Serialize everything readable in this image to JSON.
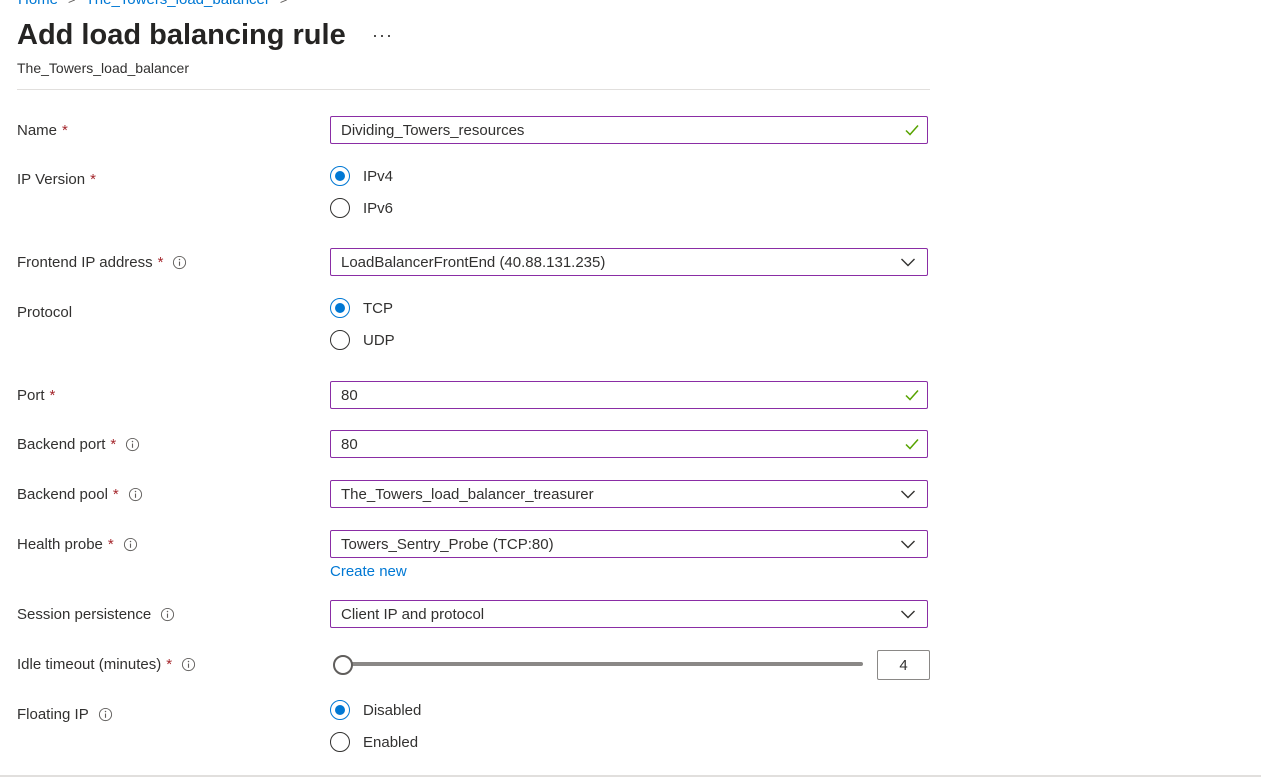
{
  "breadcrumb": {
    "items": [
      "Home",
      "The_Towers_load_balancer"
    ],
    "separator": ">"
  },
  "page": {
    "title": "Add load balancing rule",
    "more": "···",
    "subtitle": "The_Towers_load_balancer"
  },
  "form": {
    "name": {
      "label": "Name",
      "required": "*",
      "value": "Dividing_Towers_resources"
    },
    "ip_version": {
      "label": "IP Version",
      "required": "*",
      "options": [
        "IPv4",
        "IPv6"
      ],
      "selected": "IPv4"
    },
    "frontend_ip": {
      "label": "Frontend IP address",
      "required": "*",
      "value": "LoadBalancerFrontEnd (40.88.131.235)"
    },
    "protocol": {
      "label": "Protocol",
      "options": [
        "TCP",
        "UDP"
      ],
      "selected": "TCP"
    },
    "port": {
      "label": "Port",
      "required": "*",
      "value": "80"
    },
    "backend_port": {
      "label": "Backend port",
      "required": "*",
      "value": "80"
    },
    "backend_pool": {
      "label": "Backend pool",
      "required": "*",
      "value": "The_Towers_load_balancer_treasurer"
    },
    "health_probe": {
      "label": "Health probe",
      "required": "*",
      "value": "Towers_Sentry_Probe (TCP:80)",
      "create_new": "Create new"
    },
    "session_persistence": {
      "label": "Session persistence",
      "value": "Client IP and protocol"
    },
    "idle_timeout": {
      "label": "Idle timeout (minutes)",
      "required": "*",
      "value": "4"
    },
    "floating_ip": {
      "label": "Floating IP",
      "options": [
        "Disabled",
        "Enabled"
      ],
      "selected": "Disabled"
    }
  },
  "colors": {
    "accent": "#0078d4",
    "required": "#a4262c",
    "field_border": "#8a2da5",
    "valid_check": "#57a300"
  }
}
